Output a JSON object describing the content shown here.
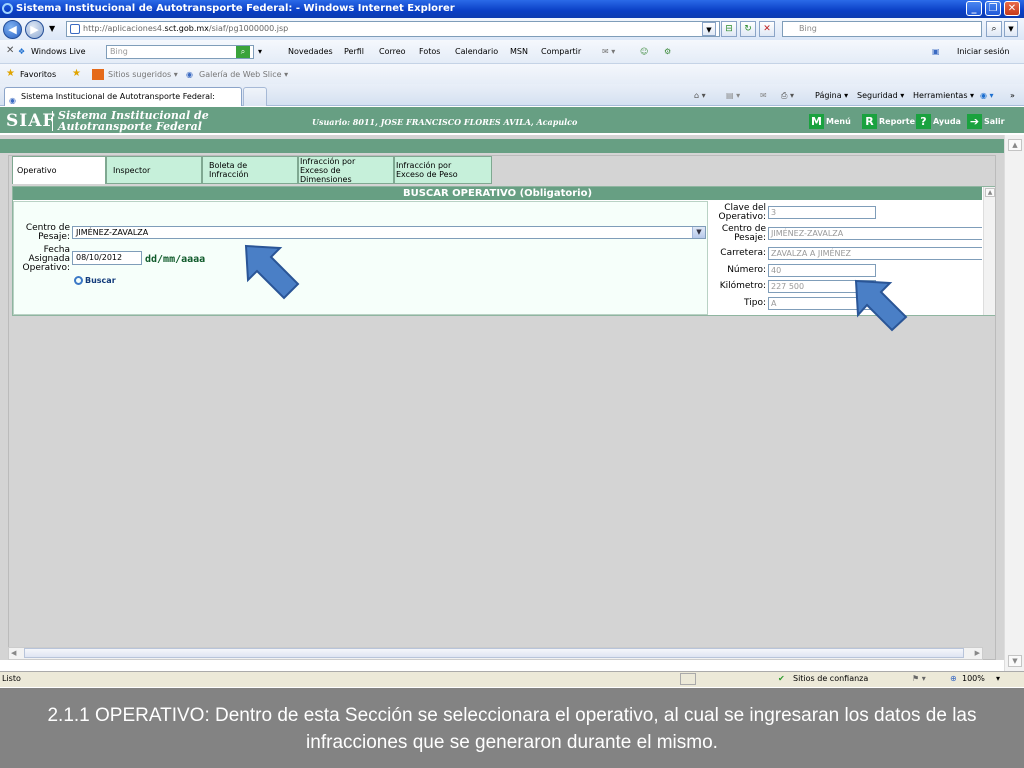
{
  "browser": {
    "window_title": "Sistema Institucional de Autotransporte Federal: - Windows Internet Explorer",
    "url_prefix": "http://aplicaciones4.",
    "url_domain": "sct.gob.mx",
    "url_suffix": "/siaf/pg1000000.jsp",
    "search_placeholder": "Bing",
    "live_toolbar": {
      "windows_live": "Windows Live",
      "search_placeholder": "Bing",
      "items": [
        "Novedades",
        "Perfil",
        "Correo",
        "Fotos",
        "Calendario",
        "MSN",
        "Compartir"
      ],
      "signin": "Iniciar sesión"
    },
    "favorites_bar": {
      "favorites": "Favoritos",
      "suggested": "Sitios sugeridos ▾",
      "gallery": "Galería de Web Slice ▾"
    },
    "tab_title": "Sistema Institucional de Autotransporte Federal:",
    "command_bar": {
      "page": "Página ▾",
      "security": "Seguridad ▾",
      "tools": "Herramientas ▾"
    },
    "status": {
      "left": "Listo",
      "zone": "Sitios de confianza",
      "zoom": "100%"
    }
  },
  "siaf": {
    "logo": "SIAF",
    "subtitle_line1": "Sistema Institucional de",
    "subtitle_line2": "Autotransporte Federal",
    "user_info": "Usuario: 8011, JOSE FRANCISCO FLORES AVILA, Acapulco",
    "buttons": {
      "menu_icon": "M",
      "menu": "Menú",
      "report_icon": "R",
      "report": "Reporte",
      "help_icon": "?",
      "help": "Ayuda",
      "exit": "Salir"
    },
    "tabs": [
      {
        "label": "Operativo"
      },
      {
        "label": "Inspector"
      },
      {
        "label": "Boleta de Infracción"
      },
      {
        "label": "Infracción por Exceso de Dimensiones"
      },
      {
        "label": "Infracción por Exceso de Peso"
      }
    ],
    "panel_title": "BUSCAR OPERATIVO (Obligatorio)",
    "form": {
      "centro_label_1": "Centro de",
      "centro_label_2": "Pesaje:",
      "centro_value": "JIMÉNEZ-ZAVALZA",
      "fecha_label_1": "Fecha",
      "fecha_label_2": "Asignada",
      "fecha_label_3": "Operativo:",
      "fecha_value": "08/10/2012",
      "fecha_format": "dd/mm/aaaa",
      "search_button": "Buscar"
    },
    "details": {
      "clave_label_1": "Clave del",
      "clave_label_2": "Operativo:",
      "clave_value": "3",
      "centro_label_1": "Centro de",
      "centro_label_2": "Pesaje:",
      "centro_value": "JIMÉNEZ-ZAVALZA",
      "carretera_label": "Carretera:",
      "carretera_value": "ZAVALZA A JIMÉNEZ",
      "numero_label": "Número:",
      "numero_value": "40",
      "kilometro_label": "Kilómetro:",
      "kilometro_value": "227 500",
      "tipo_label": "Tipo:",
      "tipo_value": "A"
    }
  },
  "caption": "2.1.1 OPERATIVO: Dentro de esta Sección se seleccionara el operativo, al cual se ingresaran los datos de las infracciones que se generaron durante el mismo.",
  "colors": {
    "siaf_green": "#679f83",
    "tab_green": "#c6f0da",
    "arrow_blue": "#4a7fc6",
    "caption_bg": "#838383"
  }
}
